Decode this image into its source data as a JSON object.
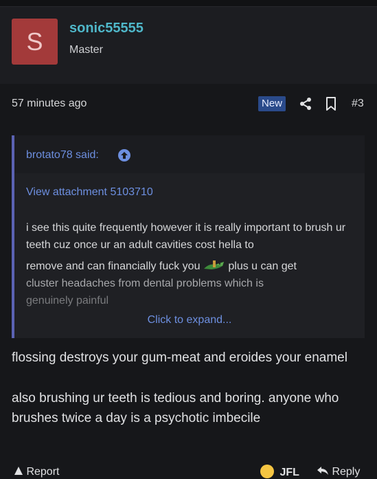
{
  "author": {
    "avatar_letter": "S",
    "avatar_color": "#a33a3a",
    "username": "sonic55555",
    "title": "Master"
  },
  "post_meta": {
    "time": "57 minutes ago",
    "badge": "New",
    "post_number": "#3",
    "share_icon": "share-icon",
    "bookmark_icon": "bookmark-icon"
  },
  "quote": {
    "attribution": "brotato78 said:",
    "attachment_link": "View attachment 5103710",
    "line1": "i see this quite frequently however it is really important to brush ur teeth cuz once ur an adult cavities cost hella to",
    "line2a": "remove and can financially fuck you",
    "line2b": "plus u can get",
    "line3": "cluster headaches from dental problems which is",
    "line4": "genuinely painful",
    "expand": "Click to expand..."
  },
  "body": {
    "paragraph1": "flossing destroys your gum-meat and eroides your enamel",
    "paragraph2": "also brushing ur teeth is tedious and boring. anyone who brushes twice a day is a psychotic imbecile"
  },
  "footer": {
    "report": "Report",
    "reaction": "JFL",
    "reply": "Reply"
  },
  "colors": {
    "link": "#6d8fe0",
    "username": "#4fb7c9",
    "quote_border": "#5b62b3",
    "new_badge": "#2a4a8a"
  }
}
